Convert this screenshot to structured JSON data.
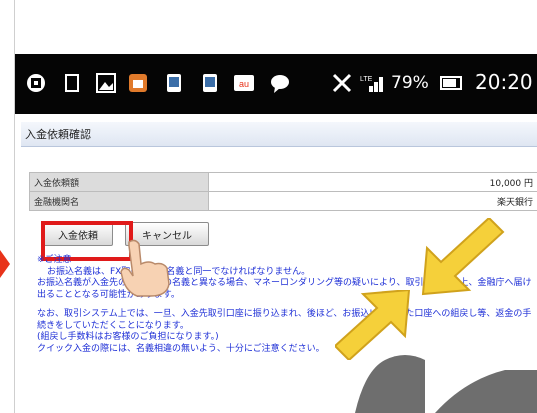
{
  "status_bar": {
    "battery_percent": "79%",
    "time": "20:20",
    "lte_label": "LTE"
  },
  "page": {
    "title": "入金依頼確認"
  },
  "form": {
    "rows": [
      {
        "label": "入金依頼額",
        "value": "10,000 円"
      },
      {
        "label": "金融機関名",
        "value": "楽天銀行"
      }
    ]
  },
  "buttons": {
    "submit_label": "入金依頼",
    "cancel_label": "キャンセル"
  },
  "notice": {
    "heading": "※ご注意",
    "line1": "お振込名義は、FX取引口座の名義と同一でなければなりません。",
    "line2": "お振込名義が入金先の取引口座の名義と異なる場合、マネーロンダリング等の疑いにより、取引を停止の上、金融庁へ届け出ることとなる可能性があります。",
    "line3": "なお、取引システム上では、一旦、入金先取引口座に振り込まれ、後ほど、お振込いただいた口座への組戻し等、返金の手続きをしていただくことになります。",
    "line4": "(組戻し手数料はお客様のご負担になります。)",
    "line5": "クイック入金の際には、名義相違の無いよう、十分にご注意ください。"
  },
  "icons": [
    "cast-icon",
    "square-icon",
    "gallery-icon",
    "home-app-icon",
    "phone-app-icon",
    "phone-app-icon",
    "au-icon",
    "chat-icon",
    "vibrate-off-icon",
    "signal-icon",
    "battery-icon"
  ],
  "colors": {
    "highlight": "#e01a1a",
    "arrow": "#f5d03a",
    "notice_text": "#1e2fd6"
  }
}
